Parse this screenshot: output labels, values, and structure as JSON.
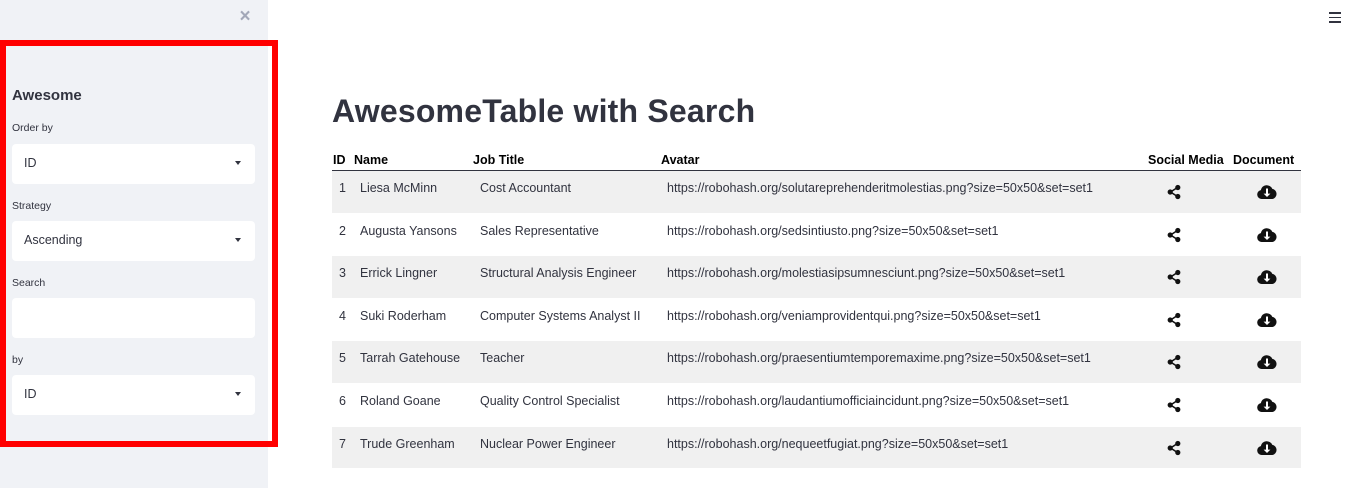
{
  "sidebar": {
    "title": "Awesome",
    "order_by_label": "Order by",
    "order_by_value": "ID",
    "strategy_label": "Strategy",
    "strategy_value": "Ascending",
    "search_label": "Search",
    "search_value": "",
    "by_label": "by",
    "by_value": "ID",
    "close_icon": "close-icon"
  },
  "main": {
    "title": "AwesomeTable with Search",
    "menu_icon": "hamburger-menu-icon"
  },
  "table": {
    "headers": [
      "ID",
      "Name",
      "Job Title",
      "Avatar",
      "Social Media",
      "Document"
    ],
    "rows": [
      {
        "id": "1",
        "name": "Liesa McMinn",
        "job": "Cost Accountant",
        "avatar": "https://robohash.org/solutareprehenderitmolestias.png?size=50x50&set=set1"
      },
      {
        "id": "2",
        "name": "Augusta Yansons",
        "job": "Sales Representative",
        "avatar": "https://robohash.org/sedsintiusto.png?size=50x50&set=set1"
      },
      {
        "id": "3",
        "name": "Errick Lingner",
        "job": "Structural Analysis Engineer",
        "avatar": "https://robohash.org/molestiasipsumnesciunt.png?size=50x50&set=set1"
      },
      {
        "id": "4",
        "name": "Suki Roderham",
        "job": "Computer Systems Analyst II",
        "avatar": "https://robohash.org/veniamprovidentqui.png?size=50x50&set=set1"
      },
      {
        "id": "5",
        "name": "Tarrah Gatehouse",
        "job": "Teacher",
        "avatar": "https://robohash.org/praesentiumtemporemaxime.png?size=50x50&set=set1"
      },
      {
        "id": "6",
        "name": "Roland Goane",
        "job": "Quality Control Specialist",
        "avatar": "https://robohash.org/laudantiumofficiaincidunt.png?size=50x50&set=set1"
      },
      {
        "id": "7",
        "name": "Trude Greenham",
        "job": "Nuclear Power Engineer",
        "avatar": "https://robohash.org/nequeetfugiat.png?size=50x50&set=set1"
      }
    ],
    "social_icon": "share-icon",
    "document_icon": "cloud-download-icon"
  },
  "colors": {
    "sidebar_bg": "#f0f2f6",
    "highlight_frame": "#ff0000",
    "row_stripe": "#f0f0f0",
    "text": "#31333f"
  }
}
